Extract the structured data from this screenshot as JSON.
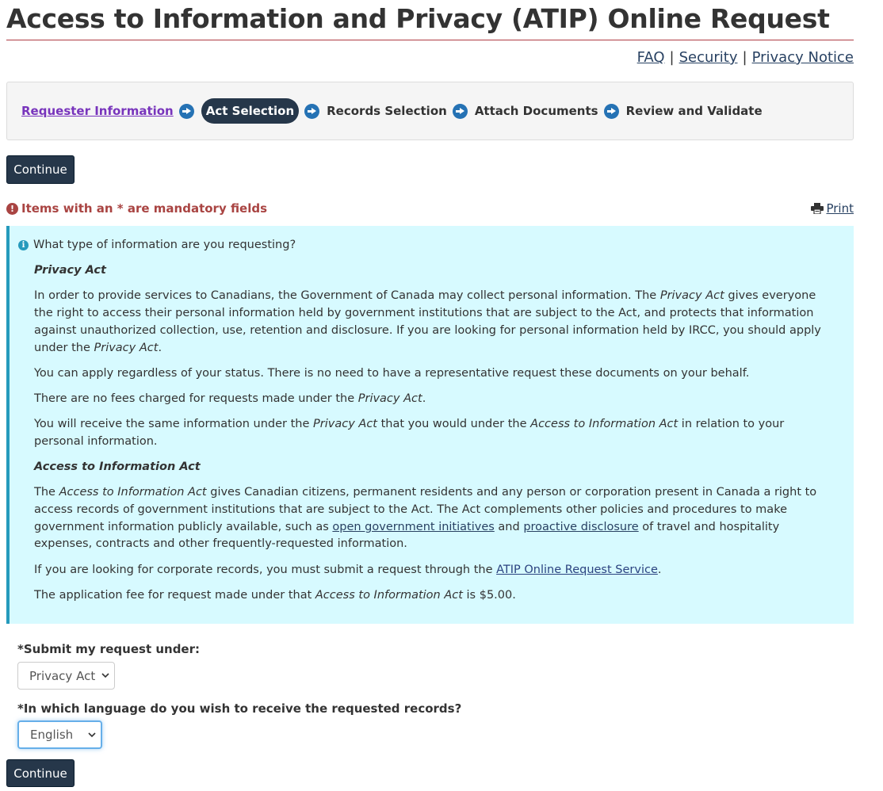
{
  "page_title": "Access to Information and Privacy (ATIP) Online Request",
  "top_links": {
    "faq": "FAQ",
    "security": "Security",
    "privacy_notice": "Privacy Notice",
    "separator": "|"
  },
  "steps": [
    {
      "label": "Requester Information",
      "state": "link"
    },
    {
      "label": "Act Selection",
      "state": "active"
    },
    {
      "label": "Records Selection",
      "state": "pending"
    },
    {
      "label": "Attach Documents",
      "state": "pending"
    },
    {
      "label": "Review and Validate",
      "state": "pending"
    }
  ],
  "continue_label": "Continue",
  "mandatory_note": "Items with an * are mandatory fields",
  "print_label": "Print",
  "info": {
    "question": "What type of information are you requesting?",
    "privacy_heading": "Privacy Act",
    "p1_a": "In order to provide services to Canadians, the Government of Canada may collect personal information. The ",
    "p1_em": "Privacy Act",
    "p1_b": " gives everyone the right to access their personal information held by government institutions that are subject to the Act, and protects that information against unauthorized collection, use, retention and disclosure. If you are looking for personal information held by IRCC, you should apply under the ",
    "p1_em2": "Privacy Act",
    "p1_c": ".",
    "p2": "You can apply regardless of your status. There is no need to have a representative request these documents on your behalf.",
    "p3_a": "There are no fees charged for requests made under the ",
    "p3_em": "Privacy Act",
    "p3_b": ".",
    "p4_a": "You will receive the same information under the ",
    "p4_em": "Privacy Act",
    "p4_b": " that you would under the ",
    "p4_em2": "Access to Information Act",
    "p4_c": " in relation to your personal information.",
    "ati_heading": "Access to Information Act",
    "p5_a": "The ",
    "p5_em": "Access to Information Act",
    "p5_b": " gives Canadian citizens, permanent residents and any person or corporation present in Canada a right to access records of government institutions that are subject to the Act. The Act complements other policies and procedures to make government information publicly available, such as ",
    "p5_link1": "open government initiatives",
    "p5_c": " and ",
    "p5_link2": "proactive disclosure",
    "p5_d": " of travel and hospitality expenses, contracts and other frequently-requested information.",
    "p6_a": "If you are looking for corporate records, you must submit a request through the ",
    "p6_link": "ATIP Online Request Service",
    "p6_b": ".",
    "p7_a": "The application fee for request made under that ",
    "p7_em": "Access to Information Act",
    "p7_b": " is $5.00."
  },
  "form": {
    "act_label": "*Submit my request under:",
    "act_value": "Privacy Act",
    "language_label": "*In which language do you wish to receive the requested records?",
    "language_value": "English"
  },
  "colors": {
    "navy": "#26374a",
    "rule": "#af3c43",
    "alert": "#a94442",
    "info_bg": "#d7faff",
    "info_border": "#269abc",
    "visited": "#7834bc",
    "arrow": "#2572b4"
  }
}
